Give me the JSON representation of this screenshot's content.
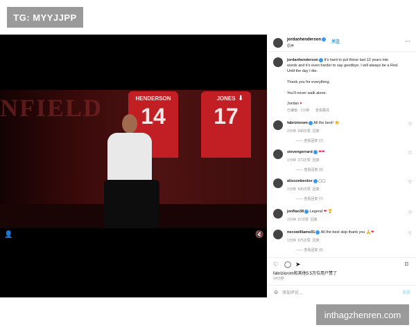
{
  "watermarks": {
    "top": "TG: MYYJJPP",
    "bottom": "inthagzhenren.com"
  },
  "media": {
    "banner_text": "NFIELD",
    "shirts": [
      {
        "name": "HENDERSON",
        "number": "14"
      },
      {
        "name": "JONES",
        "number": "17"
      }
    ]
  },
  "post": {
    "username": "jordanhenderson",
    "follow_label": "关注",
    "subtitle": "原声",
    "caption_lines": [
      "It's hard to put these last 12 years into",
      "words and it's even harder to say goodbye. I will always be a Red.",
      "Until the day I die."
    ],
    "thanks": "Thank you for everything.",
    "yna": "You'll never walk alone.",
    "sign": "Jordan",
    "time": "已编辑 · 1分钟",
    "translate": "查看翻译"
  },
  "comments": [
    {
      "user": "fabriziorom",
      "text": "All the best!",
      "emoji": "👏",
      "time": "2分钟",
      "likes": "938次赞",
      "reply": "回复",
      "view": "查看回复 (7)"
    },
    {
      "user": "stevengerrard",
      "text": "",
      "emoji": "❤❤",
      "time": "1分钟",
      "likes": "373次赞",
      "reply": "回复",
      "view": "查看回复 (9)"
    },
    {
      "user": "alissonbecker",
      "text": "",
      "emoji": "▢▢",
      "time": "2分钟",
      "likes": "695次赞",
      "reply": "回复",
      "view": "查看回复 (7)"
    },
    {
      "user": "jonflan38",
      "text": "Legend",
      "emoji": "❤ 🏆",
      "time": "2分钟",
      "likes": "57次赞",
      "reply": "回复",
      "view": ""
    },
    {
      "user": "necowilliams01",
      "text": "All the best skip thank you",
      "emoji": "🙏❤",
      "time": "1分钟",
      "likes": "875次赞",
      "reply": "回复",
      "view": "查看回复 (6)"
    }
  ],
  "footer": {
    "likes": "fabriziorom和其他5.5万位用户赞了",
    "time": "14分钟",
    "comment_placeholder": "添加评论...",
    "post": "发布"
  }
}
